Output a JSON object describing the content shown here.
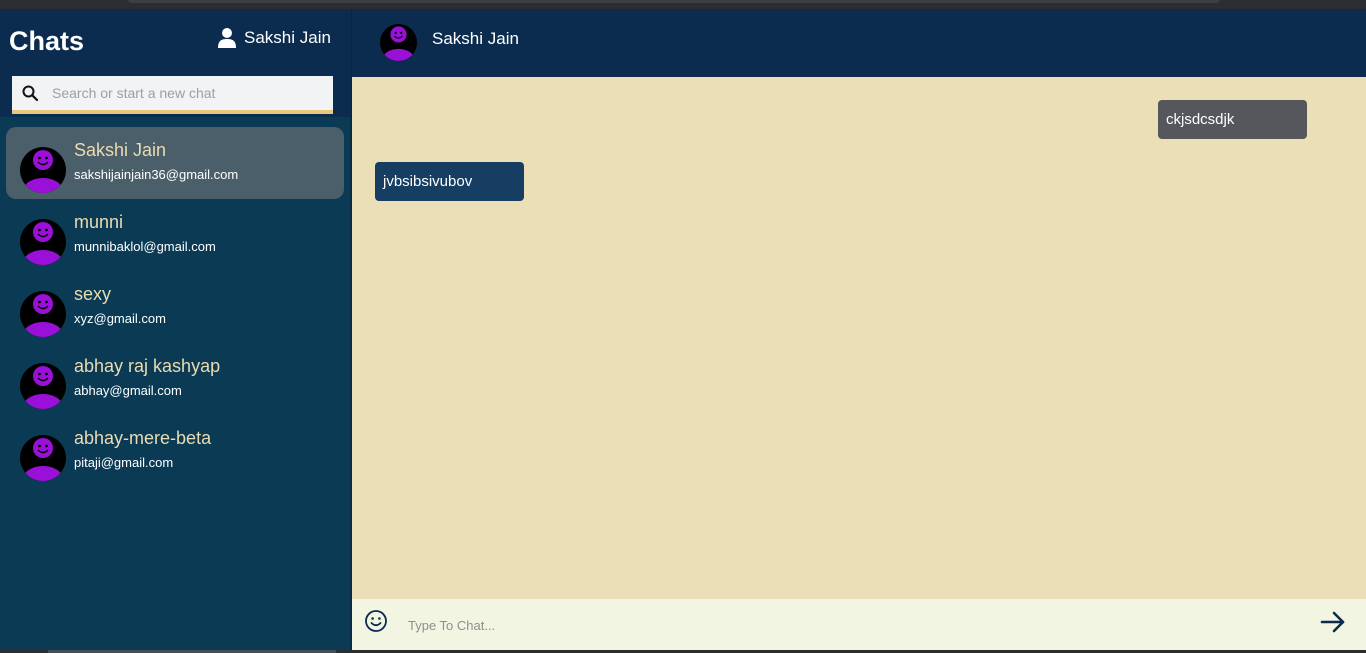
{
  "sidebar": {
    "title": "Chats",
    "current_user": "Sakshi Jain",
    "search": {
      "placeholder": "Search or start a new chat",
      "value": ""
    },
    "chats": [
      {
        "name": "Sakshi Jain",
        "email": "sakshijainjain36@gmail.com",
        "active": true
      },
      {
        "name": "munni",
        "email": "munnibaklol@gmail.com",
        "active": false
      },
      {
        "name": "sexy",
        "email": "xyz@gmail.com",
        "active": false
      },
      {
        "name": "abhay raj kashyap",
        "email": "abhay@gmail.com",
        "active": false
      },
      {
        "name": "abhay-mere-beta",
        "email": "pitaji@gmail.com",
        "active": false
      }
    ]
  },
  "conversation": {
    "contact_name": "Sakshi Jain",
    "messages": [
      {
        "text": "ckjsdcsdjk",
        "direction": "outgoing"
      },
      {
        "text": "jvbsibsivubov",
        "direction": "incoming"
      }
    ]
  },
  "composer": {
    "placeholder": "Type To Chat...",
    "value": ""
  },
  "icons": {
    "user": "person-icon",
    "search": "search-icon",
    "emoji": "emoji-icon",
    "send": "send-arrow-icon",
    "avatar": "smiley-avatar-icon"
  },
  "colors": {
    "header_bg": "#0b2c4e",
    "sidebar_bg": "#0b3a55",
    "chat_bg": "#ebdfb7",
    "outgoing_bubble": "#56575d",
    "incoming_bubble": "#163e63",
    "composer_bg": "#f2f5e1",
    "accent": "#e9c77f",
    "avatar_purple": "#9b10d8"
  }
}
